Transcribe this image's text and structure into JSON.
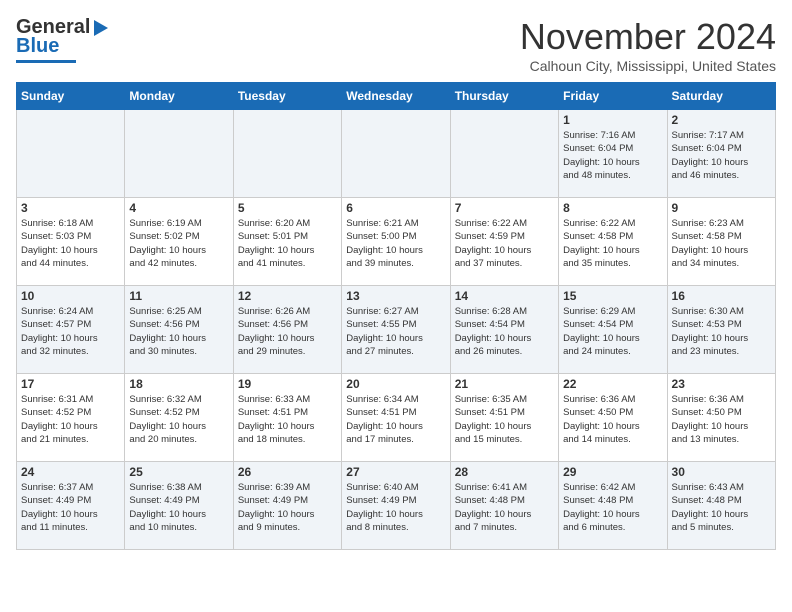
{
  "logo": {
    "text1": "General",
    "text2": "Blue"
  },
  "title": "November 2024",
  "subtitle": "Calhoun City, Mississippi, United States",
  "weekdays": [
    "Sunday",
    "Monday",
    "Tuesday",
    "Wednesday",
    "Thursday",
    "Friday",
    "Saturday"
  ],
  "weeks": [
    [
      {
        "day": "",
        "info": ""
      },
      {
        "day": "",
        "info": ""
      },
      {
        "day": "",
        "info": ""
      },
      {
        "day": "",
        "info": ""
      },
      {
        "day": "",
        "info": ""
      },
      {
        "day": "1",
        "info": "Sunrise: 7:16 AM\nSunset: 6:04 PM\nDaylight: 10 hours\nand 48 minutes."
      },
      {
        "day": "2",
        "info": "Sunrise: 7:17 AM\nSunset: 6:04 PM\nDaylight: 10 hours\nand 46 minutes."
      }
    ],
    [
      {
        "day": "3",
        "info": "Sunrise: 6:18 AM\nSunset: 5:03 PM\nDaylight: 10 hours\nand 44 minutes."
      },
      {
        "day": "4",
        "info": "Sunrise: 6:19 AM\nSunset: 5:02 PM\nDaylight: 10 hours\nand 42 minutes."
      },
      {
        "day": "5",
        "info": "Sunrise: 6:20 AM\nSunset: 5:01 PM\nDaylight: 10 hours\nand 41 minutes."
      },
      {
        "day": "6",
        "info": "Sunrise: 6:21 AM\nSunset: 5:00 PM\nDaylight: 10 hours\nand 39 minutes."
      },
      {
        "day": "7",
        "info": "Sunrise: 6:22 AM\nSunset: 4:59 PM\nDaylight: 10 hours\nand 37 minutes."
      },
      {
        "day": "8",
        "info": "Sunrise: 6:22 AM\nSunset: 4:58 PM\nDaylight: 10 hours\nand 35 minutes."
      },
      {
        "day": "9",
        "info": "Sunrise: 6:23 AM\nSunset: 4:58 PM\nDaylight: 10 hours\nand 34 minutes."
      }
    ],
    [
      {
        "day": "10",
        "info": "Sunrise: 6:24 AM\nSunset: 4:57 PM\nDaylight: 10 hours\nand 32 minutes."
      },
      {
        "day": "11",
        "info": "Sunrise: 6:25 AM\nSunset: 4:56 PM\nDaylight: 10 hours\nand 30 minutes."
      },
      {
        "day": "12",
        "info": "Sunrise: 6:26 AM\nSunset: 4:56 PM\nDaylight: 10 hours\nand 29 minutes."
      },
      {
        "day": "13",
        "info": "Sunrise: 6:27 AM\nSunset: 4:55 PM\nDaylight: 10 hours\nand 27 minutes."
      },
      {
        "day": "14",
        "info": "Sunrise: 6:28 AM\nSunset: 4:54 PM\nDaylight: 10 hours\nand 26 minutes."
      },
      {
        "day": "15",
        "info": "Sunrise: 6:29 AM\nSunset: 4:54 PM\nDaylight: 10 hours\nand 24 minutes."
      },
      {
        "day": "16",
        "info": "Sunrise: 6:30 AM\nSunset: 4:53 PM\nDaylight: 10 hours\nand 23 minutes."
      }
    ],
    [
      {
        "day": "17",
        "info": "Sunrise: 6:31 AM\nSunset: 4:52 PM\nDaylight: 10 hours\nand 21 minutes."
      },
      {
        "day": "18",
        "info": "Sunrise: 6:32 AM\nSunset: 4:52 PM\nDaylight: 10 hours\nand 20 minutes."
      },
      {
        "day": "19",
        "info": "Sunrise: 6:33 AM\nSunset: 4:51 PM\nDaylight: 10 hours\nand 18 minutes."
      },
      {
        "day": "20",
        "info": "Sunrise: 6:34 AM\nSunset: 4:51 PM\nDaylight: 10 hours\nand 17 minutes."
      },
      {
        "day": "21",
        "info": "Sunrise: 6:35 AM\nSunset: 4:51 PM\nDaylight: 10 hours\nand 15 minutes."
      },
      {
        "day": "22",
        "info": "Sunrise: 6:36 AM\nSunset: 4:50 PM\nDaylight: 10 hours\nand 14 minutes."
      },
      {
        "day": "23",
        "info": "Sunrise: 6:36 AM\nSunset: 4:50 PM\nDaylight: 10 hours\nand 13 minutes."
      }
    ],
    [
      {
        "day": "24",
        "info": "Sunrise: 6:37 AM\nSunset: 4:49 PM\nDaylight: 10 hours\nand 11 minutes."
      },
      {
        "day": "25",
        "info": "Sunrise: 6:38 AM\nSunset: 4:49 PM\nDaylight: 10 hours\nand 10 minutes."
      },
      {
        "day": "26",
        "info": "Sunrise: 6:39 AM\nSunset: 4:49 PM\nDaylight: 10 hours\nand 9 minutes."
      },
      {
        "day": "27",
        "info": "Sunrise: 6:40 AM\nSunset: 4:49 PM\nDaylight: 10 hours\nand 8 minutes."
      },
      {
        "day": "28",
        "info": "Sunrise: 6:41 AM\nSunset: 4:48 PM\nDaylight: 10 hours\nand 7 minutes."
      },
      {
        "day": "29",
        "info": "Sunrise: 6:42 AM\nSunset: 4:48 PM\nDaylight: 10 hours\nand 6 minutes."
      },
      {
        "day": "30",
        "info": "Sunrise: 6:43 AM\nSunset: 4:48 PM\nDaylight: 10 hours\nand 5 minutes."
      }
    ]
  ]
}
